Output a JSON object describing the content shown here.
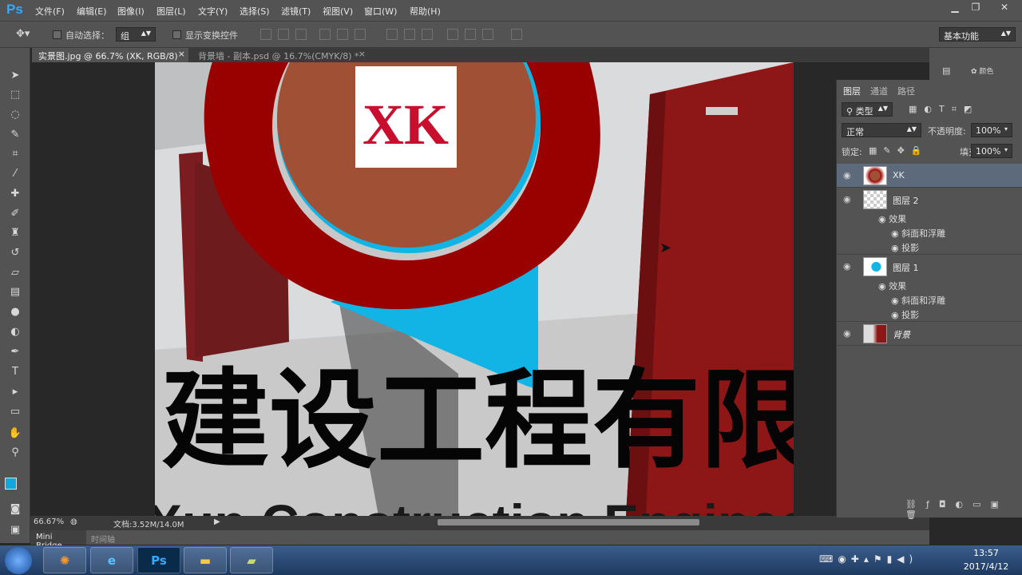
{
  "app": {
    "logo": "Ps"
  },
  "menu": [
    "文件(F)",
    "编辑(E)",
    "图像(I)",
    "图层(L)",
    "文字(Y)",
    "选择(S)",
    "滤镜(T)",
    "视图(V)",
    "窗口(W)",
    "帮助(H)"
  ],
  "options": {
    "auto_select_label": "自动选择：",
    "auto_select_value": "组",
    "show_transform_label": "显示变换控件",
    "workspace": "基本功能"
  },
  "tabs": [
    {
      "label": "实景图.jpg @ 66.7% (XK, RGB/8) *",
      "close": "×"
    },
    {
      "label": "背景墙 - 副本.psd @ 16.7%(CMYK/8) *",
      "close": "×"
    }
  ],
  "canvas": {
    "logo_text": "XK",
    "cn_text": "建设工程有限",
    "en_text": "Xun Construction Enginee"
  },
  "status": {
    "zoom": "66.67%",
    "doc": "文档:3.52M/14.0M"
  },
  "bottom_tabs": {
    "mini_bridge": "Mini Bridge",
    "timeline": "时间轴"
  },
  "right_panel": {
    "btn_label": "颜色"
  },
  "layers_panel": {
    "tabs": [
      "图层",
      "通道",
      "路径"
    ],
    "filter": "类型",
    "blend_mode": "正常",
    "opacity_label": "不透明度:",
    "opacity_value": "100%",
    "lock_label": "锁定:",
    "fill_label": "填充:",
    "fill_value": "100%",
    "layers": [
      {
        "name": "XK"
      },
      {
        "name": "图层 2",
        "effects_label": "效果",
        "effects": [
          "斜面和浮雕",
          "投影"
        ]
      },
      {
        "name": "图层 1",
        "effects_label": "效果",
        "effects": [
          "斜面和浮雕",
          "投影"
        ]
      },
      {
        "name": "背景"
      }
    ]
  },
  "taskbar": {
    "time": "13:57",
    "date": "2017/4/12",
    "ps_label": "Ps"
  },
  "colors": {
    "accent": "#33a9ff",
    "panel": "#535353",
    "selected_layer": "#5d6a7c",
    "logo_red": "#990000",
    "logo_brown": "#a05035",
    "cyan": "#12b4e6"
  }
}
